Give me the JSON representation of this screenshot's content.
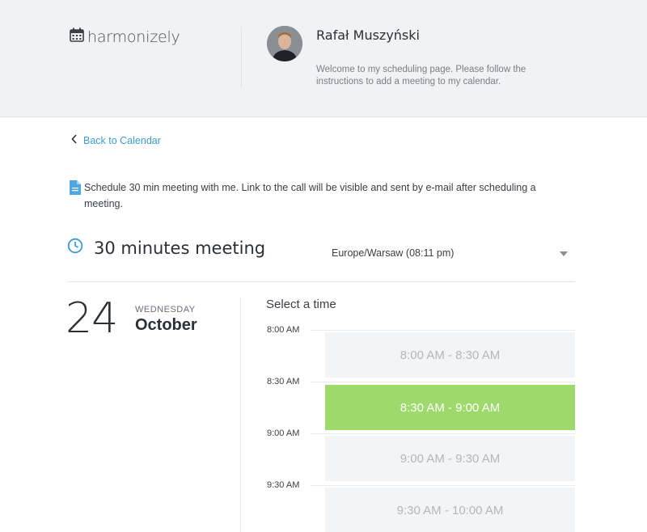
{
  "header": {
    "logo_text": "harmonizely",
    "host_name": "Rafał Muszyński",
    "welcome": "Welcome to my scheduling page. Please follow the instructions to add a meeting to my calendar."
  },
  "nav": {
    "back_label": "Back to Calendar"
  },
  "description": "Schedule 30 min meeting with me. Link to the call will be visible and sent by e-mail after scheduling a meeting.",
  "meeting": {
    "title": "30 minutes meeting",
    "timezone": "Europe/Warsaw (08:11 pm)"
  },
  "date": {
    "day": "24",
    "weekday": "WEDNESDAY",
    "month": "October"
  },
  "select_title": "Select a time",
  "time_labels": [
    "8:00 AM",
    "8:30 AM",
    "9:00 AM",
    "9:30 AM"
  ],
  "slots": [
    {
      "label": "8:00 AM - 8:30 AM",
      "selected": false
    },
    {
      "label": "8:30 AM - 9:00 AM",
      "selected": true
    },
    {
      "label": "9:00 AM - 9:30 AM",
      "selected": false
    },
    {
      "label": "9:30 AM - 10:00 AM",
      "selected": false
    }
  ],
  "colors": {
    "accent": "#3d9bd9",
    "selected": "#9ed96b",
    "header_bg": "#f0f2f4"
  },
  "icons": [
    "calendar-icon",
    "chevron-left-icon",
    "document-icon",
    "clock-icon",
    "caret-down-icon"
  ]
}
